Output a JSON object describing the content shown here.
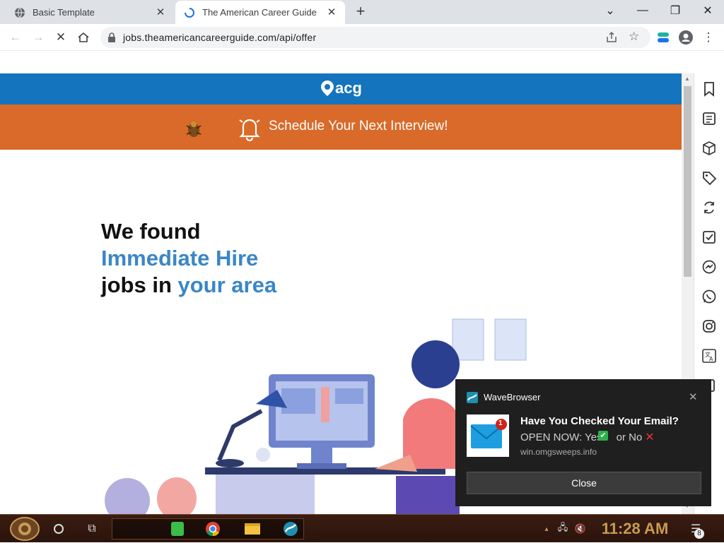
{
  "browser": {
    "tabs": [
      {
        "title": "Basic Template",
        "active": false
      },
      {
        "title": "The American Career Guide",
        "active": true
      }
    ],
    "new_tab_label": "+",
    "url": "jobs.theamericancareerguide.com/api/offer"
  },
  "page": {
    "logo_text": "acg",
    "promo_text": "Schedule Your Next Interview!",
    "hero": {
      "line1": "We found",
      "line2": "Immediate Hire",
      "line3_a": "jobs in ",
      "line3_b": "your area"
    }
  },
  "notification": {
    "app": "WaveBrowser",
    "title": "Have You Checked Your Email?",
    "body_prefix": "OPEN NOW: Yes",
    "body_mid": " or No",
    "domain": "win.omgsweeps.info",
    "badge": "1",
    "button": "Close"
  },
  "taskbar": {
    "time": "11:28 AM",
    "notification_count": "8"
  },
  "colors": {
    "brand_blue": "#1474bd",
    "promo_orange": "#d96a29",
    "hero_blue": "#3a86c7"
  }
}
